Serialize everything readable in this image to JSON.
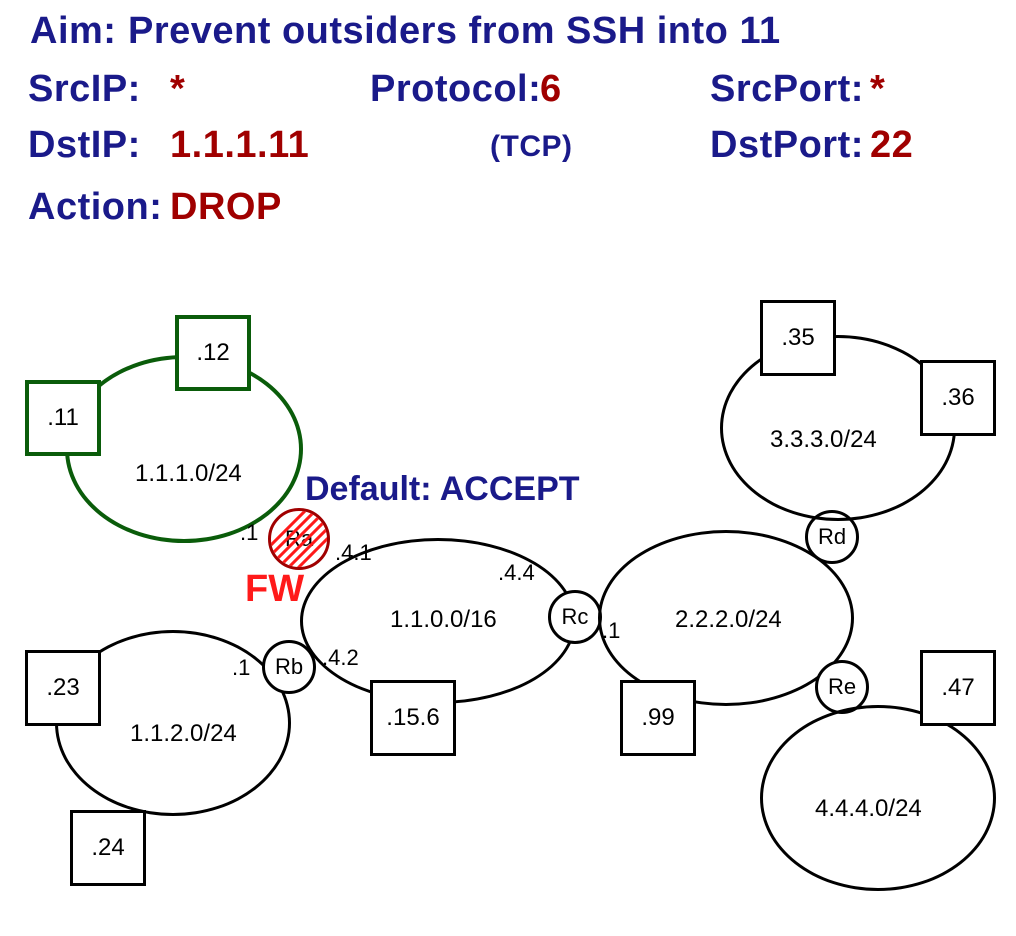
{
  "header": {
    "aim_label": "Aim:",
    "aim_value": "Prevent outsiders from SSH into 11",
    "srcip_label": "SrcIP:",
    "srcip_value": "*",
    "protocol_label": "Protocol:",
    "protocol_value": "6",
    "protocol_note": "(TCP)",
    "srcport_label": "SrcPort:",
    "srcport_value": "*",
    "dstip_label": "DstIP:",
    "dstip_value": "1.1.1.11",
    "dstport_label": "DstPort:",
    "dstport_value": "22",
    "action_label": "Action:",
    "action_value": "DROP"
  },
  "annot": {
    "default": "Default: ACCEPT",
    "fw": "FW"
  },
  "subnets": {
    "s1": "1.1.1.0/24",
    "s2": "1.1.2.0/24",
    "backbone": "1.1.0.0/16",
    "s3": "2.2.2.0/24",
    "s4": "3.3.3.0/24",
    "s5": "4.4.4.0/24"
  },
  "routers": {
    "ra": "Ra",
    "rb": "Rb",
    "rc": "Rc",
    "rd": "Rd",
    "re": "Re"
  },
  "hosts": {
    "h11": ".11",
    "h12": ".12",
    "h23": ".23",
    "h24": ".24",
    "h156": ".15.6",
    "h99": ".99",
    "h35": ".35",
    "h36": ".36",
    "h47": ".47"
  },
  "ifaces": {
    "ra_s1": ".1",
    "ra_bb": ".4.1",
    "rb_s2": ".1",
    "rb_bb": ".4.2",
    "rc_bb": ".4.4",
    "rc_s3": ".1"
  }
}
